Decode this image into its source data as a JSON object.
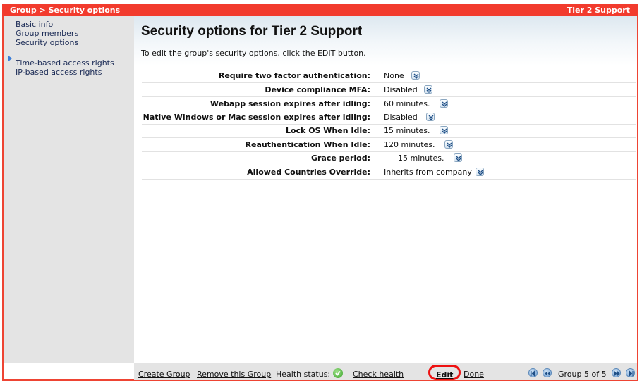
{
  "titlebar": {
    "breadcrumb": "Group > Security options",
    "group_name": "Tier 2 Support"
  },
  "sidebar": {
    "items": [
      {
        "label": "Basic info"
      },
      {
        "label": "Group members"
      },
      {
        "label": "Security options",
        "active": true
      },
      {
        "label": "Time-based access rights"
      },
      {
        "label": "IP-based access rights"
      }
    ]
  },
  "main": {
    "title": "Security options for Tier 2 Support",
    "instructions": "To edit the group's security options, click the EDIT button.",
    "settings": [
      {
        "label": "Require two factor authentication:",
        "value": "None"
      },
      {
        "label": "Device compliance MFA:",
        "value": "Disabled"
      },
      {
        "label": "Webapp session expires after idling:",
        "value": "60 minutes."
      },
      {
        "label": "Native Windows or Mac session expires after idling:",
        "value": "Disabled"
      },
      {
        "label": "Lock OS When Idle:",
        "value": "15 minutes."
      },
      {
        "label": "Reauthentication When Idle:",
        "value": "120 minutes."
      },
      {
        "label": "Grace period:",
        "value": "15 minutes."
      },
      {
        "label": "Allowed Countries Override:",
        "value": "Inherits from company"
      }
    ]
  },
  "footer": {
    "create_group": "Create Group",
    "remove_group": "Remove this Group",
    "health_status_label": "Health status:",
    "health_status_icon": "green-check-icon",
    "check_health": "Check health",
    "edit": "Edit",
    "done": "Done",
    "pager": "Group 5 of 5"
  },
  "colors": {
    "titlebar": "#f23b2d",
    "sidebar": "#e4e4e4",
    "highlight": "#ee1111"
  }
}
